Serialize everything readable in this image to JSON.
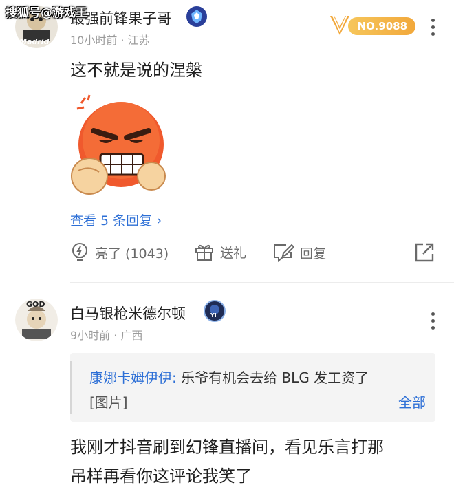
{
  "watermark": "搜狐号@游戏王",
  "comment1": {
    "username": "最强前锋果子哥",
    "avatar_caption": "Madrid",
    "badge_icon": "esports-badge-icon",
    "time": "10小时前 · 江苏",
    "rank_label": "NO.9088",
    "text": "这不就是说的涅槃",
    "sticker": "angry-face-fist-sticker",
    "view_replies": "查看 5 条回复",
    "actions": {
      "like": "亮了 (1043)",
      "gift": "送礼",
      "reply": "回复"
    }
  },
  "comment2": {
    "username": "白马银枪米德尔顿",
    "avatar_caption": "GOD",
    "badge_label": "YI",
    "time": "9小时前 · 广西",
    "quote": {
      "user": "康娜卡姆伊伊:",
      "text": " 乐爷有机会去给 BLG 发工资了",
      "image_label": "[图片]",
      "all_label": "全部"
    },
    "text_line1": "我刚才抖音刷到幻锋直播间，看见乐言打那",
    "text_line2": "吊样再看你这评论我笑了"
  },
  "colors": {
    "link": "#2d6fd6",
    "rank_gold": "#f2a83b",
    "muted": "#9a9a9a"
  }
}
